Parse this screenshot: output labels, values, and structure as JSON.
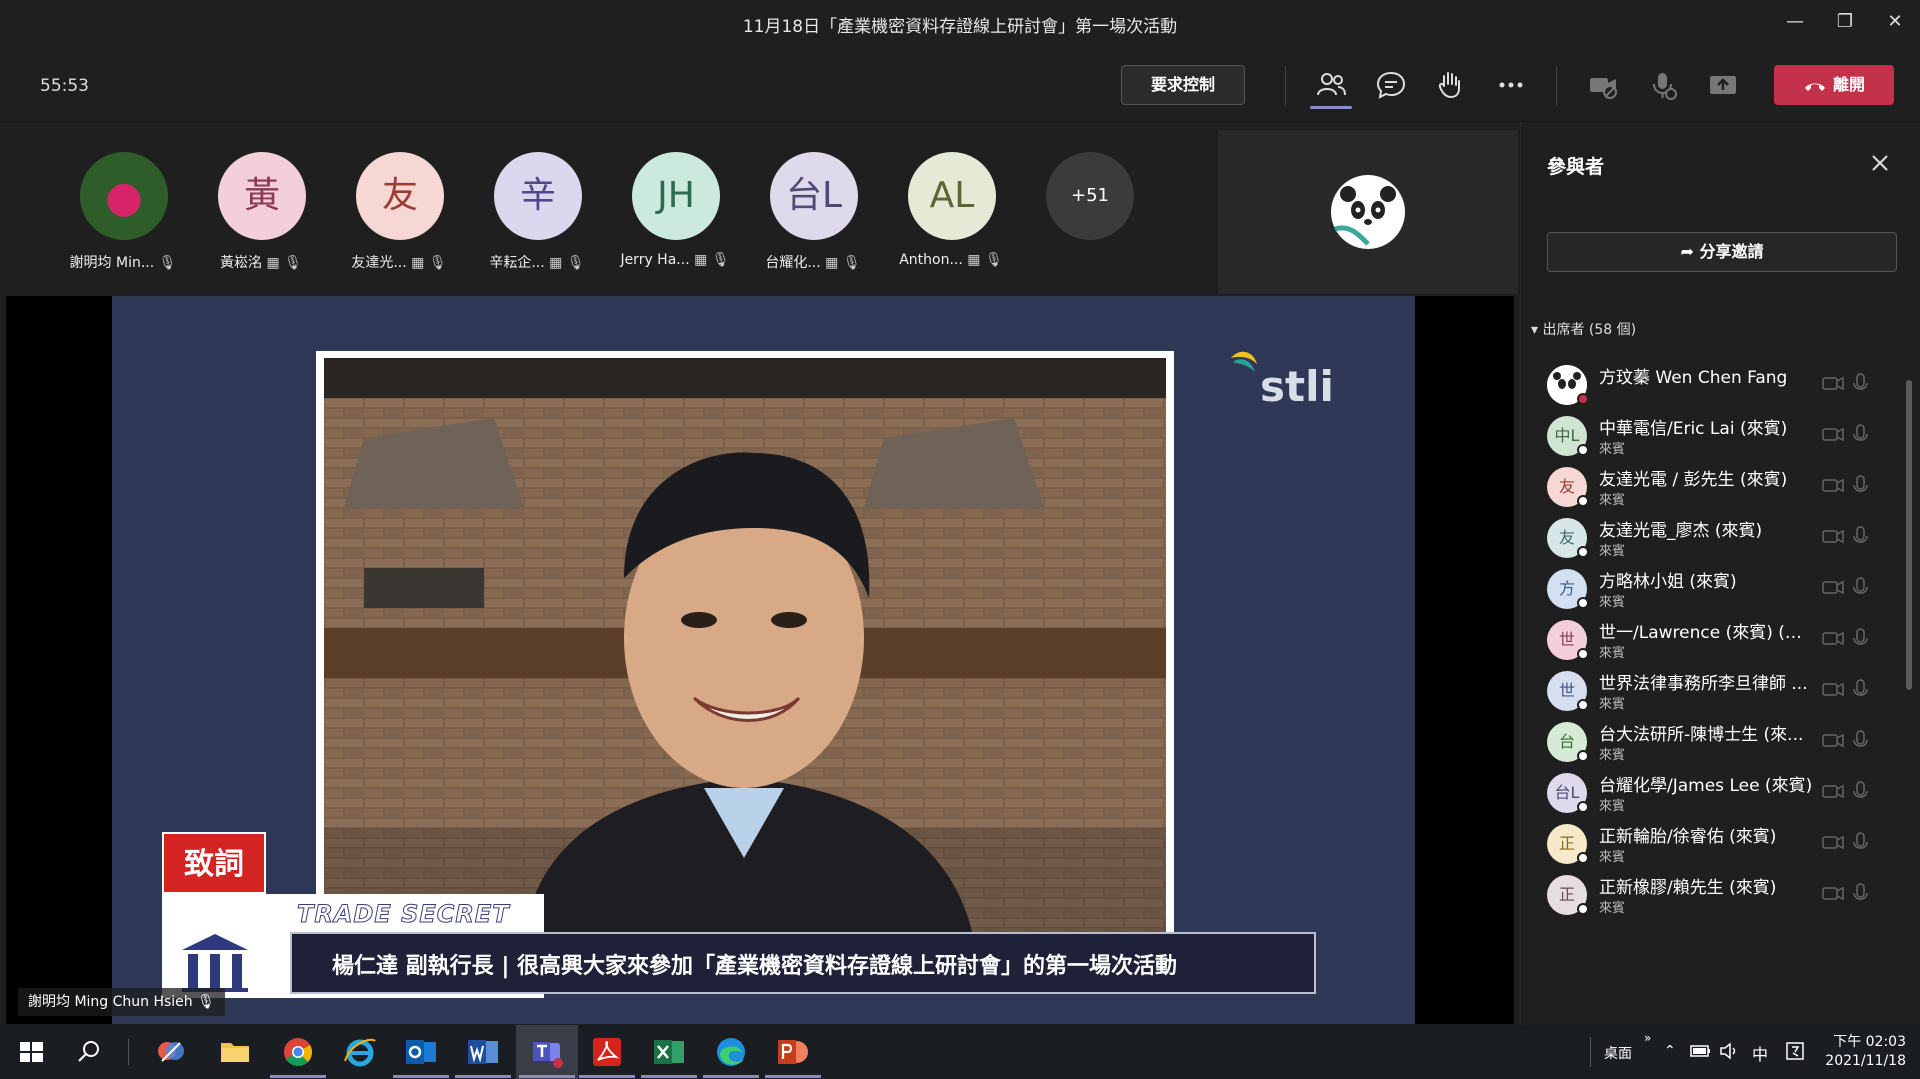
{
  "window": {
    "title": "11月18日「產業機密資料存證線上研討會」第一場次活動"
  },
  "toolbar": {
    "timer": "55:53",
    "request_control": "要求控制",
    "leave": "離開"
  },
  "gallery": {
    "participants": [
      {
        "name": "謝明均 Min...",
        "initials": "",
        "bg": "#6b6b6b"
      },
      {
        "name": "黃崧洺",
        "initials": "黃",
        "bg": "#f3d0d9",
        "fg": "#8b3a52"
      },
      {
        "name": "友達光...",
        "initials": "友",
        "bg": "#f6d7d3",
        "fg": "#9a3d35"
      },
      {
        "name": "辛耘企...",
        "initials": "辛",
        "bg": "#dad7ef",
        "fg": "#4f4a87"
      },
      {
        "name": "Jerry Ha...",
        "initials": "JH",
        "bg": "#cbe9dc",
        "fg": "#2d6b4f"
      },
      {
        "name": "台耀化...",
        "initials": "台L",
        "bg": "#dfd9ec",
        "fg": "#4f4a75"
      },
      {
        "name": "Anthon...",
        "initials": "AL",
        "bg": "#e5ead6",
        "fg": "#5b6630"
      }
    ],
    "overflow": "+51"
  },
  "stage": {
    "presenter_label": "謝明均 Ming Chun Hsieh",
    "slide": {
      "brand": "stli",
      "tag": "致詞",
      "band": "TRADE SECRET",
      "caption": "楊仁達 副執行長 | 很高興大家來參加「產業機密資料存證線上研討會」的第一場次活動"
    }
  },
  "panel": {
    "title": "參與者",
    "share": "分享邀請",
    "attendees_header": "出席者 (58 個)",
    "people": [
      {
        "name": "方玟蓁 Wen Chen Fang",
        "role": "",
        "initials": "",
        "bg": "#ffffff",
        "fg": "#333"
      },
      {
        "name": "中華電信/Eric Lai (來賓)",
        "role": "來賓",
        "initials": "中L",
        "bg": "#cfe5d2",
        "fg": "#3d6b45"
      },
      {
        "name": "友達光電 / 彭先生 (來賓)",
        "role": "來賓",
        "initials": "友",
        "bg": "#f6d7d3",
        "fg": "#9a3d35"
      },
      {
        "name": "友達光電_廖杰 (來賓)",
        "role": "來賓",
        "initials": "友",
        "bg": "#d7e6e6",
        "fg": "#3f6a6a"
      },
      {
        "name": "方略林小姐 (來賓)",
        "role": "來賓",
        "initials": "方",
        "bg": "#d3e0f1",
        "fg": "#3b5c87"
      },
      {
        "name": "世一/Lawrence (來賓) (來...",
        "role": "來賓",
        "initials": "世",
        "bg": "#f3d0d9",
        "fg": "#8b3a52"
      },
      {
        "name": "世界法律事務所李旦律師 ...",
        "role": "來賓",
        "initials": "世",
        "bg": "#d6def0",
        "fg": "#3e5685"
      },
      {
        "name": "台大法研所-陳博士生 (來...",
        "role": "來賓",
        "initials": "台",
        "bg": "#d6ebd5",
        "fg": "#3f6b3c"
      },
      {
        "name": "台耀化學/James Lee (來賓)",
        "role": "來賓",
        "initials": "台L",
        "bg": "#dfd9ec",
        "fg": "#4f4a75"
      },
      {
        "name": "正新輪胎/徐睿佑 (來賓)",
        "role": "來賓",
        "initials": "正",
        "bg": "#f6e8c8",
        "fg": "#8a6a1e"
      },
      {
        "name": "正新橡膠/賴先生 (來賓)",
        "role": "來賓",
        "initials": "正",
        "bg": "#e6dde0",
        "fg": "#6b4a55"
      }
    ]
  },
  "taskbar": {
    "desktop": "桌面",
    "ime": "中",
    "time": "下午 02:03",
    "date": "2021/11/18"
  }
}
